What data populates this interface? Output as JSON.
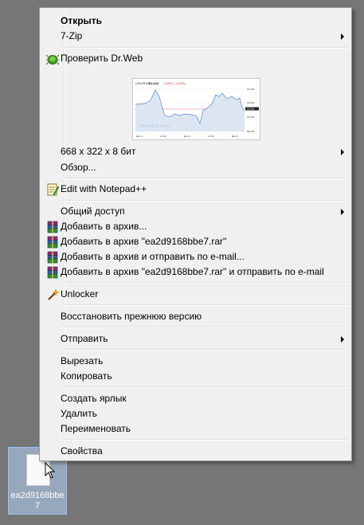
{
  "menu": {
    "open": "Открыть",
    "seven_zip": "7-Zip",
    "drweb": "Проверить Dr.Web",
    "thumbnail": {
      "title": "USD/RUB",
      "price": "61,412",
      "change": "-0,952 (-1,53%)",
      "watermark": "Investing.com",
      "y_ticks": [
        "64,000",
        "62,000",
        "61,412",
        "60,000",
        "58,000"
      ],
      "x_ticks": [
        "Дек 9",
        "12:00",
        "Дек 9",
        "12:00",
        "Дек 9"
      ]
    },
    "image_info": "668 x 322 x 8 бит",
    "browse": "Обзор...",
    "notepad": "Edit with Notepad++",
    "share": "Общий доступ",
    "add_archive": "Добавить в архив...",
    "add_rar": "Добавить в архив \"ea2d9168bbe7.rar\"",
    "add_email": "Добавить в архив и отправить по e-mail...",
    "add_rar_email": "Добавить в архив \"ea2d9168bbe7.rar\" и отправить по e-mail",
    "unlocker": "Unlocker",
    "restore": "Восстановить прежнюю версию",
    "send_to": "Отправить",
    "cut": "Вырезать",
    "copy": "Копировать",
    "shortcut": "Создать ярлык",
    "delete": "Удалить",
    "rename": "Переименовать",
    "properties": "Свойства"
  },
  "desktop": {
    "file_label": "ea2d9168bbe7"
  },
  "icons": [
    "drweb-spider-icon",
    "notepad-plus-plus-icon",
    "winrar-icon",
    "unlocker-wand-icon",
    "file-icon",
    "mouse-cursor-icon"
  ],
  "colors": {
    "menu_bg": "#f0f0f0",
    "desktop_bg": "#767676",
    "selection": "#b4d2f5"
  }
}
